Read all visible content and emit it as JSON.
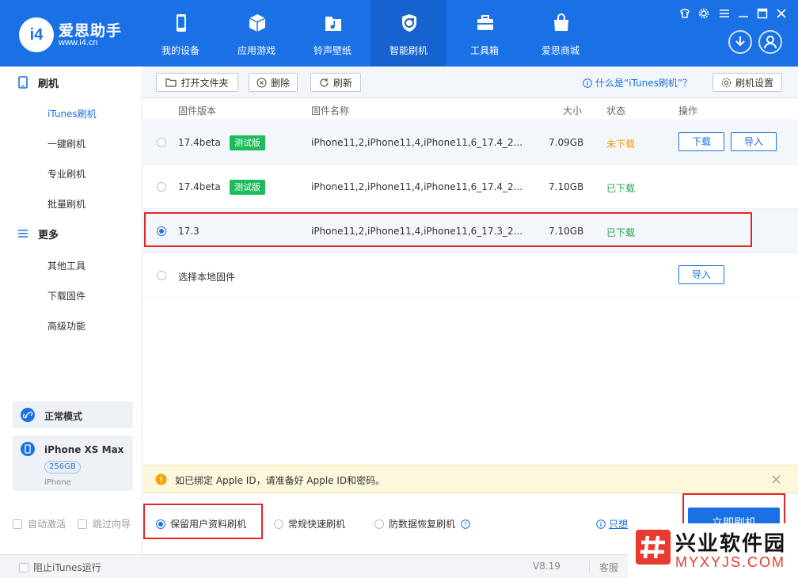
{
  "app": {
    "logo_badge": "i4",
    "title": "爱思助手",
    "url": "www.i4.cn"
  },
  "nav": [
    {
      "label": "我的设备",
      "icon": "phone-icon"
    },
    {
      "label": "应用游戏",
      "icon": "cube-icon"
    },
    {
      "label": "铃声壁纸",
      "icon": "music-folder-icon"
    },
    {
      "label": "智能刷机",
      "icon": "refresh-shield-icon",
      "active": true
    },
    {
      "label": "工具箱",
      "icon": "toolbox-icon"
    },
    {
      "label": "爱思商城",
      "icon": "shopping-bag-icon"
    }
  ],
  "sidebar": {
    "section1": "刷机",
    "section1_items": [
      "iTunes刷机",
      "一键刷机",
      "专业刷机",
      "批量刷机"
    ],
    "section2": "更多",
    "section2_items": [
      "其他工具",
      "下载固件",
      "高级功能"
    ],
    "mode": "正常模式",
    "device_name": "iPhone XS Max",
    "device_storage": "256GB",
    "device_type": "iPhone",
    "auto_activate": "自动激活",
    "skip_guide": "跳过向导"
  },
  "toolbar": {
    "open_folder": "打开文件夹",
    "delete": "删除",
    "refresh": "刷新",
    "help_link": "什么是“iTunes刷机”？",
    "settings": "刷机设置"
  },
  "table": {
    "headers": {
      "version": "固件版本",
      "name": "固件名称",
      "size": "大小",
      "status": "状态",
      "action": "操作"
    },
    "rows": [
      {
        "version": "17.4beta",
        "tag": "测试版",
        "name": "iPhone11,2,iPhone11,4,iPhone11,6_17.4_2...",
        "size": "7.09GB",
        "status": "未下载",
        "download": "下载",
        "import": "导入"
      },
      {
        "version": "17.4beta",
        "tag": "测试版",
        "name": "iPhone11,2,iPhone11,4,iPhone11,6_17.4_2...",
        "size": "7.10GB",
        "status": "已下载"
      },
      {
        "version": "17.3",
        "name": "iPhone11,2,iPhone11,4,iPhone11,6_17.3_2...",
        "size": "7.10GB",
        "status": "已下载"
      }
    ],
    "local": {
      "label": "选择本地固件",
      "import": "导入"
    }
  },
  "notice": {
    "text": "如已绑定 Apple ID，请准备好 Apple ID和密码。"
  },
  "options": {
    "keep_data": "保留用户资料刷机",
    "quick": "常规快速刷机",
    "anti_recovery": "防数据恢复刷机",
    "only_link": "只想",
    "flash_button": "立即刷机"
  },
  "statusbar": {
    "block_itunes": "阻止iTunes运行",
    "version": "V8.19",
    "service": "客服"
  },
  "watermark": {
    "line1": "兴业软件园",
    "line2": "MYXYJS.COM"
  },
  "colors": {
    "brand": "#1a71e6",
    "nav_active": "#1463cf",
    "highlight": "#e3262b",
    "success": "#1fa34a",
    "warning": "#f0a000",
    "beta_tag": "#1cbc5a"
  }
}
